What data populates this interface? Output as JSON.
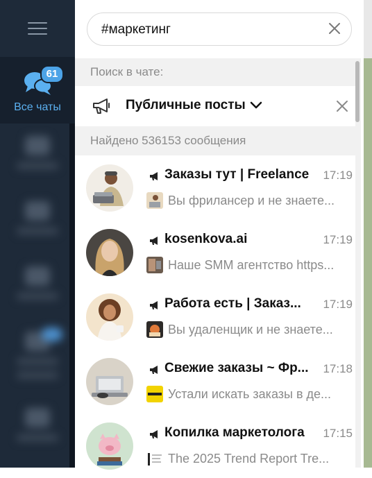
{
  "sidebar": {
    "active_folder": {
      "label": "Все чаты",
      "badge": "61",
      "icon": "chats-icon"
    }
  },
  "search": {
    "value": "#маркетинг",
    "clear_icon": "close-icon"
  },
  "search_in_chat_label": "Поиск в чате:",
  "filter": {
    "label": "Публичные посты",
    "icon": "megaphone-icon"
  },
  "results_count": "Найдено 536153 сообщения",
  "results": [
    {
      "title": "Заказы тут | Freelance",
      "time": "17:19",
      "preview": "Вы фрилансер и не знаете..."
    },
    {
      "title": "kosenkova.ai",
      "time": "17:19",
      "preview": "Наше SMM агентство https..."
    },
    {
      "title": "Работа есть | Заказ...",
      "time": "17:19",
      "preview": "Вы удаленщик и не знаете..."
    },
    {
      "title": "Свежие заказы ~ Фр...",
      "time": "17:18",
      "preview": "Устали искать заказы в де..."
    },
    {
      "title": "Копилка маркетолога",
      "time": "17:15",
      "preview": "The 2025 Trend Report  Tre..."
    }
  ],
  "colors": {
    "accent": "#4ca3e7",
    "rail": "#1e2a39",
    "active_folder": "#16202d",
    "muted_text": "#8a8a8a"
  }
}
